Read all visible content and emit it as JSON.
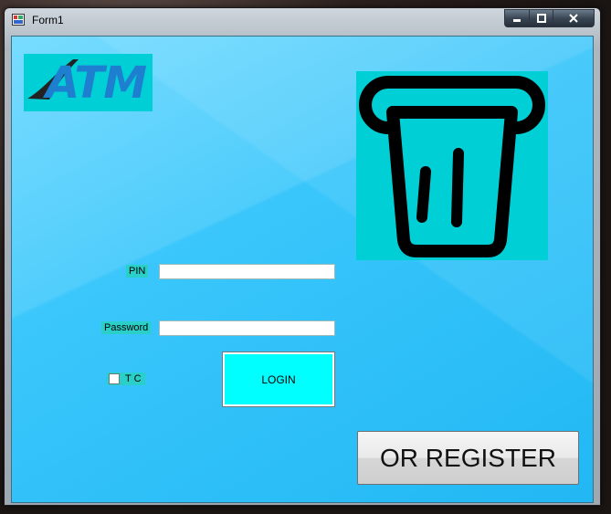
{
  "window": {
    "title": "Form1"
  },
  "caption_buttons": {
    "minimize": "minimize-icon",
    "maximize": "maximize-icon",
    "close": "close-icon"
  },
  "logo": {
    "text": "ATM"
  },
  "form": {
    "pin_label": "PIN",
    "password_label": "Password",
    "pin_value": "",
    "password_value": "",
    "tc_label": "T C",
    "login_label": "LOGIN",
    "register_label": "OR REGISTER"
  },
  "colors": {
    "client_bg": "#39c6fb",
    "logo_bg": "#00cfd6",
    "login_bg": "#00ffff",
    "label_bg": "#2ad0c8"
  }
}
